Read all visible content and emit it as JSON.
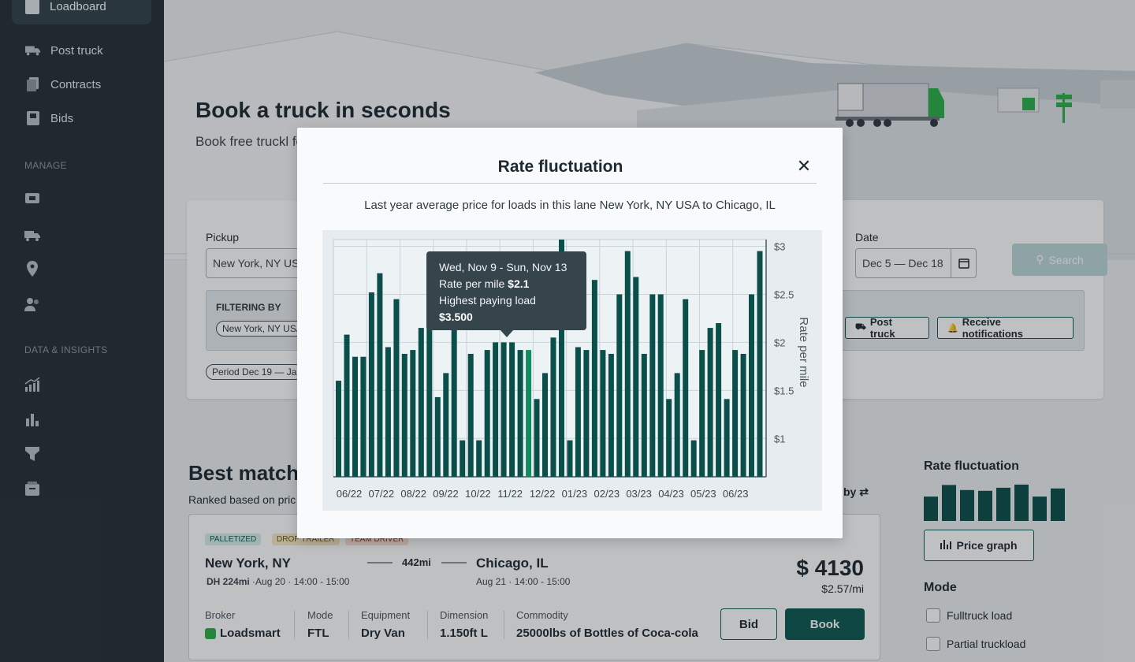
{
  "sidebar": {
    "active_item": "Loadboard",
    "items": [
      {
        "label": "Post truck",
        "icon": "truck-icon"
      },
      {
        "label": "Contracts",
        "icon": "document-icon"
      },
      {
        "label": "Bids",
        "icon": "bid-icon"
      }
    ],
    "manage_label": "MANAGE",
    "manage_icons": [
      "monitor-icon",
      "truck-icon",
      "location-pin-icon",
      "users-icon"
    ],
    "insights_label": "DATA & INSIGHTS",
    "insights_icons": [
      "trend-chart-icon",
      "bar-chart-icon",
      "funnel-icon",
      "box-icon"
    ]
  },
  "hero": {
    "title": "Book a truck in seconds",
    "subtitle": "Book free truckl for your busines"
  },
  "search": {
    "pickup_label": "Pickup",
    "pickup_value": "New York, NY USA",
    "date_label": "Date",
    "date_value": "Dec 5 — Dec 18",
    "search_label": "Search",
    "filtering_title": "FILTERING BY",
    "filter_chip": "New York, NY USA",
    "period_chip": "Period Dec 19 — Ja",
    "post_truck_label": "Post truck",
    "notifications_label": "Receive notifications"
  },
  "best_matches": {
    "title": "Best match",
    "subtitle": "Ranked based on pric",
    "sort_label": "by"
  },
  "load": {
    "tags": [
      "PALLETIZED",
      "DROP TRAILER",
      "TEAM DRIVER"
    ],
    "origin": "New York, NY",
    "origin_detail_bold": "DH 224mi",
    "origin_detail": "·Aug 20 · 14:00 - 15:00",
    "distance": "442mi",
    "destination": "Chicago, IL",
    "destination_detail": "Aug 21 · 14:00 - 15:00",
    "price": "$ 4130",
    "per_mile": "$2.57/mi",
    "columns": [
      {
        "header": "Broker",
        "value": "Loadsmart"
      },
      {
        "header": "Mode",
        "value": "FTL"
      },
      {
        "header": "Equipment",
        "value": "Dry Van"
      },
      {
        "header": "Dimension",
        "value": "1.150ft L"
      },
      {
        "header": "Commodity",
        "value": "25000lbs of Bottles of Coca-cola"
      }
    ],
    "bid_label": "Bid",
    "book_label": "Book"
  },
  "side_panel": {
    "rate_title": "Rate fluctuation",
    "mini_bars": [
      0.63,
      0.93,
      0.8,
      0.78,
      0.86,
      0.94,
      0.63,
      0.84
    ],
    "price_graph_label": "Price graph",
    "mode_title": "Mode",
    "options": [
      "Fulltruck load",
      "Partial truckload"
    ]
  },
  "modal": {
    "title": "Rate fluctuation",
    "description": "Last year average price for loads in this lane New York, NY USA to Chicago, IL",
    "tooltip": {
      "range": "Wed, Nov 9 - Sun, Nov 13",
      "rate_label": "Rate per mile",
      "rate_value": "$2.1",
      "highest_label": "Highest paying load",
      "highest_value": "$3.500"
    }
  },
  "colors": {
    "bar": "#0b4f4b",
    "bar_highlight": "#138a61",
    "primary": "#0d5a52",
    "sidebar": "#253038"
  },
  "chart_data": {
    "type": "bar",
    "ylabel": "Rate per mile",
    "ylim": [
      0.6,
      3.07
    ],
    "yticks": [
      "$1",
      "$1.5",
      "$2",
      "$2.5",
      "$3"
    ],
    "ytick_values": [
      1,
      1.5,
      2,
      2.5,
      3
    ],
    "xticks": [
      "06/22",
      "07/22",
      "08/22",
      "09/22",
      "10/22",
      "11/22",
      "12/22",
      "01/23",
      "02/23",
      "03/23",
      "04/23",
      "05/23",
      "06/23"
    ],
    "highlight_index": 23,
    "values": [
      1.6,
      2.08,
      1.85,
      1.85,
      2.52,
      2.72,
      1.95,
      2.45,
      1.88,
      1.92,
      2.15,
      2.15,
      1.43,
      1.68,
      2.15,
      0.98,
      1.88,
      0.98,
      1.92,
      2.0,
      2.0,
      2.0,
      1.92,
      1.92,
      1.41,
      1.68,
      2.05,
      3.07,
      0.98,
      1.95,
      1.92,
      2.65,
      1.92,
      1.88,
      2.5,
      2.95,
      2.68,
      1.88,
      2.5,
      2.5,
      1.41,
      1.68,
      2.45,
      0.98,
      1.92,
      2.15,
      2.2,
      1.41,
      1.92,
      1.88,
      2.5,
      2.95
    ]
  }
}
